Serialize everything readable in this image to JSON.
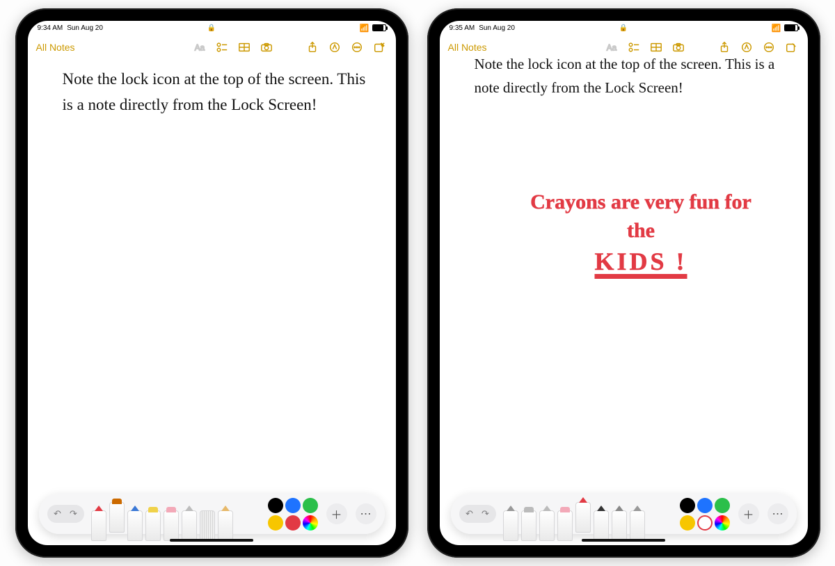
{
  "devices": [
    {
      "status": {
        "time": "9:34 AM",
        "date": "Sun Aug 20",
        "locked": true
      },
      "toolbar": {
        "back_label": "All Notes"
      },
      "handwriting_black": "Note the lock icon at the top of the screen. This is a note directly from the Lock Screen!",
      "crayon_text": "",
      "crayon_kids": "",
      "tools": [
        {
          "name": "pen",
          "tip": "#e23a44",
          "selected": false
        },
        {
          "name": "marker",
          "tip": "#cc6a00",
          "selected": true
        },
        {
          "name": "pencil",
          "tip": "#3a78d6",
          "selected": false
        },
        {
          "name": "highlighter",
          "tip": "#f0d24a",
          "selected": false
        },
        {
          "name": "eraser",
          "tip": "#f3a9b8",
          "selected": false
        },
        {
          "name": "lasso",
          "tip": "#bdbdbd",
          "selected": false
        },
        {
          "name": "ruler",
          "tip": "#bdbdbd",
          "selected": false
        },
        {
          "name": "pencil2",
          "tip": "#e7b96b",
          "selected": false
        }
      ],
      "swatches": [
        "#000000",
        "#1e73ff",
        "#2bbf4a",
        "#f7c600",
        "#e23a44",
        "rainbow"
      ],
      "selected_swatch": -1
    },
    {
      "status": {
        "time": "9:35 AM",
        "date": "Sun Aug 20",
        "locked": true
      },
      "toolbar": {
        "back_label": "All Notes"
      },
      "handwriting_black": "Note the lock icon at the top of the screen. This is a note directly from the Lock Screen!",
      "crayon_text": "Crayons are very fun for the",
      "crayon_kids": "KIDS !",
      "tools": [
        {
          "name": "pen",
          "tip": "#999",
          "selected": false
        },
        {
          "name": "marker",
          "tip": "#bbb",
          "selected": false
        },
        {
          "name": "pencil",
          "tip": "#bbb",
          "selected": false
        },
        {
          "name": "eraser",
          "tip": "#f3a9b8",
          "selected": false
        },
        {
          "name": "crayon",
          "tip": "#e23a44",
          "selected": true
        },
        {
          "name": "fountain",
          "tip": "#333",
          "selected": false
        },
        {
          "name": "brush",
          "tip": "#888",
          "selected": false
        },
        {
          "name": "pencil2",
          "tip": "#999",
          "selected": false
        }
      ],
      "swatches": [
        "#000000",
        "#1e73ff",
        "#2bbf4a",
        "#f7c600",
        "#e23a44",
        "rainbow"
      ],
      "selected_swatch": 4
    }
  ],
  "toolbar_icons": [
    "text-format",
    "checklist",
    "table",
    "camera",
    "share",
    "markup",
    "more",
    "compose"
  ],
  "colors": {
    "accent": "#cc9900",
    "crayon": "#e23a44"
  }
}
